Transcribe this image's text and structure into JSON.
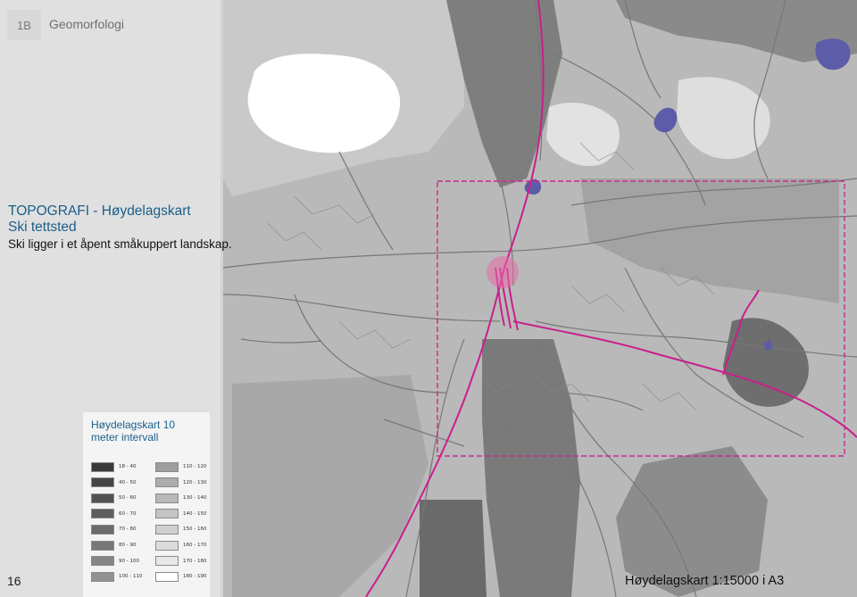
{
  "header": {
    "section_code": "1B",
    "section_title": "Geomorfologi"
  },
  "intro": {
    "title": "TOPOGRAFI - Høydelagskart",
    "subtitle": "Ski tettsted",
    "description": "Ski ligger i et åpent småkuppert landskap."
  },
  "legend": {
    "title": "Høydelagskart 10 meter intervall",
    "items": [
      {
        "label": "18 - 40",
        "color": "#3a3a3a"
      },
      {
        "label": "40 - 50",
        "color": "#454545"
      },
      {
        "label": "50 - 60",
        "color": "#525252"
      },
      {
        "label": "60 - 70",
        "color": "#5e5e5e"
      },
      {
        "label": "70 - 80",
        "color": "#6b6b6b"
      },
      {
        "label": "80 - 90",
        "color": "#787878"
      },
      {
        "label": "90 - 100",
        "color": "#858585"
      },
      {
        "label": "100 - 110",
        "color": "#929292"
      },
      {
        "label": "110 - 120",
        "color": "#9e9e9e"
      },
      {
        "label": "120 - 130",
        "color": "#ababab"
      },
      {
        "label": "130 - 140",
        "color": "#b8b8b8"
      },
      {
        "label": "140 - 150",
        "color": "#c4c4c4"
      },
      {
        "label": "150 - 160",
        "color": "#d0d0d0"
      },
      {
        "label": "160 - 170",
        "color": "#dcdcdc"
      },
      {
        "label": "170 - 180",
        "color": "#e8e8e8"
      },
      {
        "label": "180 - 190",
        "color": "#ffffff"
      }
    ]
  },
  "footer": {
    "page_number": "16",
    "scale": "Høydelagskart 1:15000 i A3"
  },
  "map_colors": {
    "railway": "#c8208c",
    "roads": "#7a7a7a",
    "water": "#5c5ca8",
    "frame": "#cc2a8a",
    "station": "#e86aa8"
  }
}
